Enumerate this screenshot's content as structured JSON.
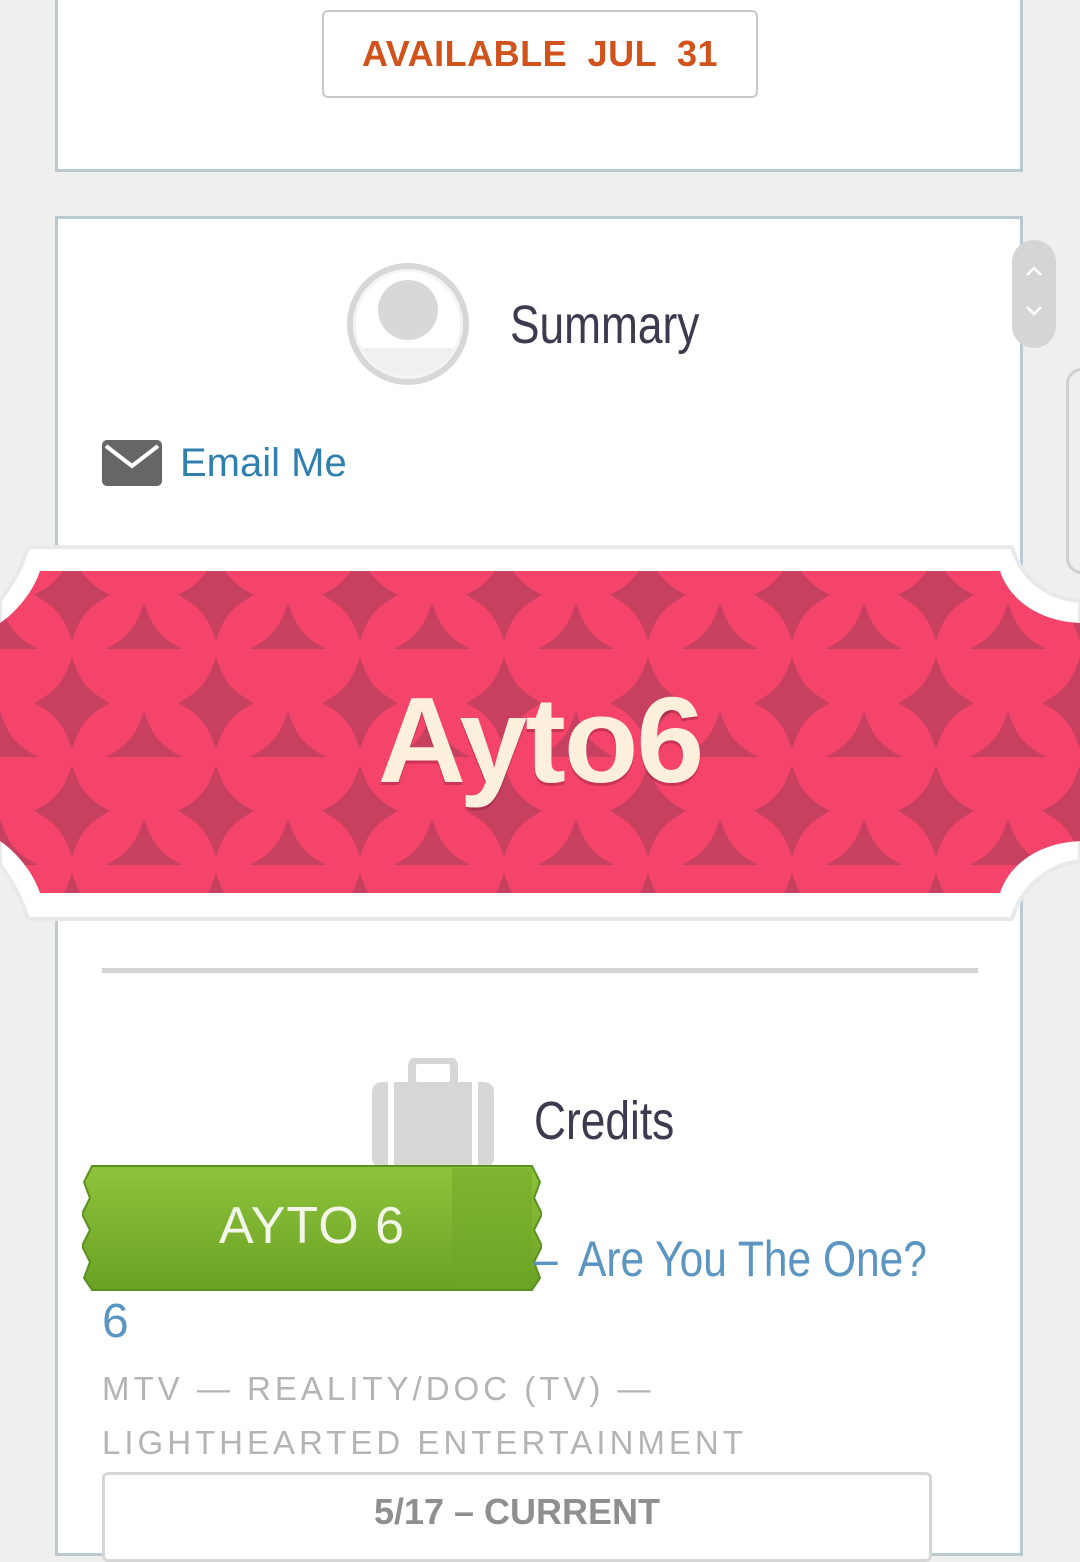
{
  "top_card": {
    "availability_label": "AVAILABLE JUL 31"
  },
  "summary": {
    "title": "Summary",
    "email_label": "Email Me"
  },
  "banner": {
    "text": "Ayto6",
    "background_color": "#f5446a",
    "pattern_color": "#c84060",
    "text_color": "#fcefdc"
  },
  "credits": {
    "title": "Credits",
    "tag_label": "AYTO 6",
    "tag_color": "#76ad2a",
    "dash": "–",
    "show_title": "Are You The One?",
    "show_number": "6",
    "meta": "MTV — REALITY/DOC (TV) — LIGHTHEARTED ENTERTAINMENT",
    "date_range": "5/17 – CURRENT"
  },
  "icons": [
    "avatar-icon",
    "envelope-icon",
    "briefcase-icon",
    "chevron-up-icon",
    "chevron-down-icon"
  ]
}
